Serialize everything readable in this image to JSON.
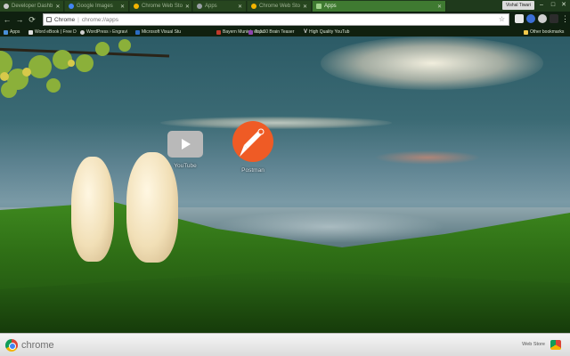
{
  "tabs": [
    {
      "label": "Developer Dashb",
      "active": false
    },
    {
      "label": "Google Images",
      "active": false
    },
    {
      "label": "Chrome Web Sto",
      "active": false
    },
    {
      "label": "Apps",
      "active": false
    },
    {
      "label": "Chrome Web Sto",
      "active": false
    },
    {
      "label": "Apps",
      "active": true
    }
  ],
  "user_name": "Vishal Tiwari",
  "window_controls": {
    "minimize": "–",
    "maximize": "□",
    "close": "✕"
  },
  "toolbar": {
    "back": "←",
    "forward": "→",
    "reload": "⟳",
    "omnibox_chip": "Chrome",
    "omnibox_url": "chrome://apps",
    "star": "☆"
  },
  "bookmarks": [
    {
      "label": "Apps",
      "color": "#4a90d9"
    },
    {
      "label": "Word eBook | Free D",
      "color": "#e0e0e0"
    },
    {
      "label": "WordPress › Engravi",
      "color": "#d0d0d0"
    },
    {
      "label": "Microsoft Visual Stu",
      "color": "#2b6cc4"
    },
    {
      "label": "Bayern Munich vs Ju",
      "color": "#c0392b"
    },
    {
      "label": "Top 50 Brain Teaser",
      "color": "#8e44ad"
    },
    {
      "label": "High Quality YouTub",
      "color": "#444444"
    }
  ],
  "other_bookmarks": "Other bookmarks",
  "apps": [
    {
      "label": "YouTube",
      "icon": "youtube-play-icon"
    },
    {
      "label": "Postman",
      "icon": "postman-icon"
    }
  ],
  "bottom": {
    "brand": "chrome",
    "webstore": "Web Store"
  },
  "colors": {
    "tab_active": "#3f7a31",
    "postman": "#ef5b25",
    "youtube_tile": "#b9b9b9"
  }
}
